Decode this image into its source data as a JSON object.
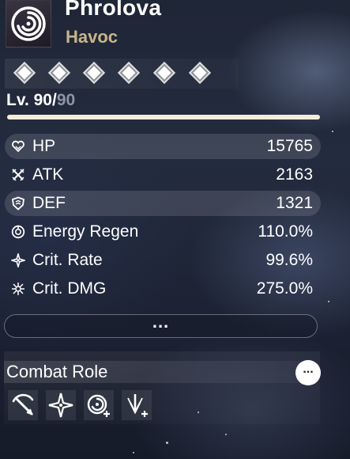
{
  "character": {
    "name": "Phrolova",
    "element": "Havoc",
    "avatar_icon": "havoc-spiral-icon"
  },
  "resonance_chain": {
    "nodes": [
      "diamond-icon",
      "diamond-icon",
      "diamond-icon",
      "diamond-icon",
      "diamond-icon",
      "diamond-icon"
    ]
  },
  "level": {
    "prefix": "Lv. 90/",
    "max": "90",
    "progress": 1.0
  },
  "stats": [
    {
      "label": "HP",
      "value": "15765",
      "icon": "heart-icon"
    },
    {
      "label": "ATK",
      "value": "2163",
      "icon": "crossed-swords-icon"
    },
    {
      "label": "DEF",
      "value": "1321",
      "icon": "shield-icon"
    },
    {
      "label": "Energy Regen",
      "value": "110.0%",
      "icon": "energy-regen-icon"
    },
    {
      "label": "Crit. Rate",
      "value": "99.6%",
      "icon": "sparkle-icon"
    },
    {
      "label": "Crit. DMG",
      "value": "275.0%",
      "icon": "crit-burst-icon"
    }
  ],
  "more_button": {
    "label": "..."
  },
  "combat_role": {
    "title": "Combat Role",
    "more_label": "...",
    "icons": [
      "scythe-slash-icon",
      "four-point-star-icon",
      "spiral-plus-icon",
      "downward-strike-plus-icon"
    ]
  },
  "colors": {
    "element_gold": "#c9b58a",
    "level_bar": "#f3ecd8",
    "level_max_gray": "#8d94a3"
  }
}
